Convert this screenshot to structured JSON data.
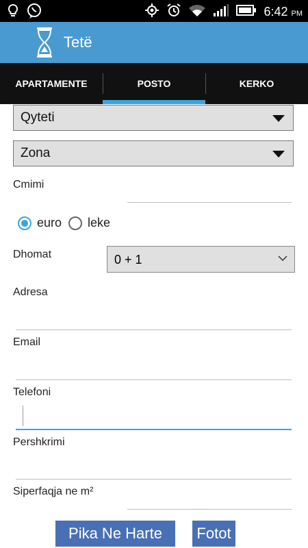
{
  "status_bar": {
    "time": "6:42",
    "ampm": "PM",
    "left_icons": [
      "lightbulb-icon",
      "viber-icon"
    ],
    "right_icons": [
      "gps-icon",
      "alarm-icon",
      "wifi-icon",
      "signal-icon",
      "battery-icon"
    ]
  },
  "app": {
    "title": "Tetë",
    "icon": "hourglass-icon",
    "accent": "#4a9ad2"
  },
  "tabs": [
    {
      "label": "APARTAMENTE",
      "active": false
    },
    {
      "label": "POSTO",
      "active": true
    },
    {
      "label": "KERKO",
      "active": false
    }
  ],
  "form": {
    "qyteti": "Qyteti",
    "zona": "Zona",
    "cmimi_label": "Cmimi",
    "currency": {
      "options": [
        "euro",
        "leke"
      ],
      "selected": "euro"
    },
    "dhomat_label": "Dhomat",
    "dhomat_value": "0 + 1",
    "adresa_label": "Adresa",
    "email_label": "Email",
    "telefoni_label": "Telefoni",
    "pershkrimi_label": "Pershkrimi",
    "siperfaqja_label": "Siperfaqja ne m²"
  },
  "buttons": {
    "map": "Pika Ne Harte",
    "photos": "Fotot"
  }
}
